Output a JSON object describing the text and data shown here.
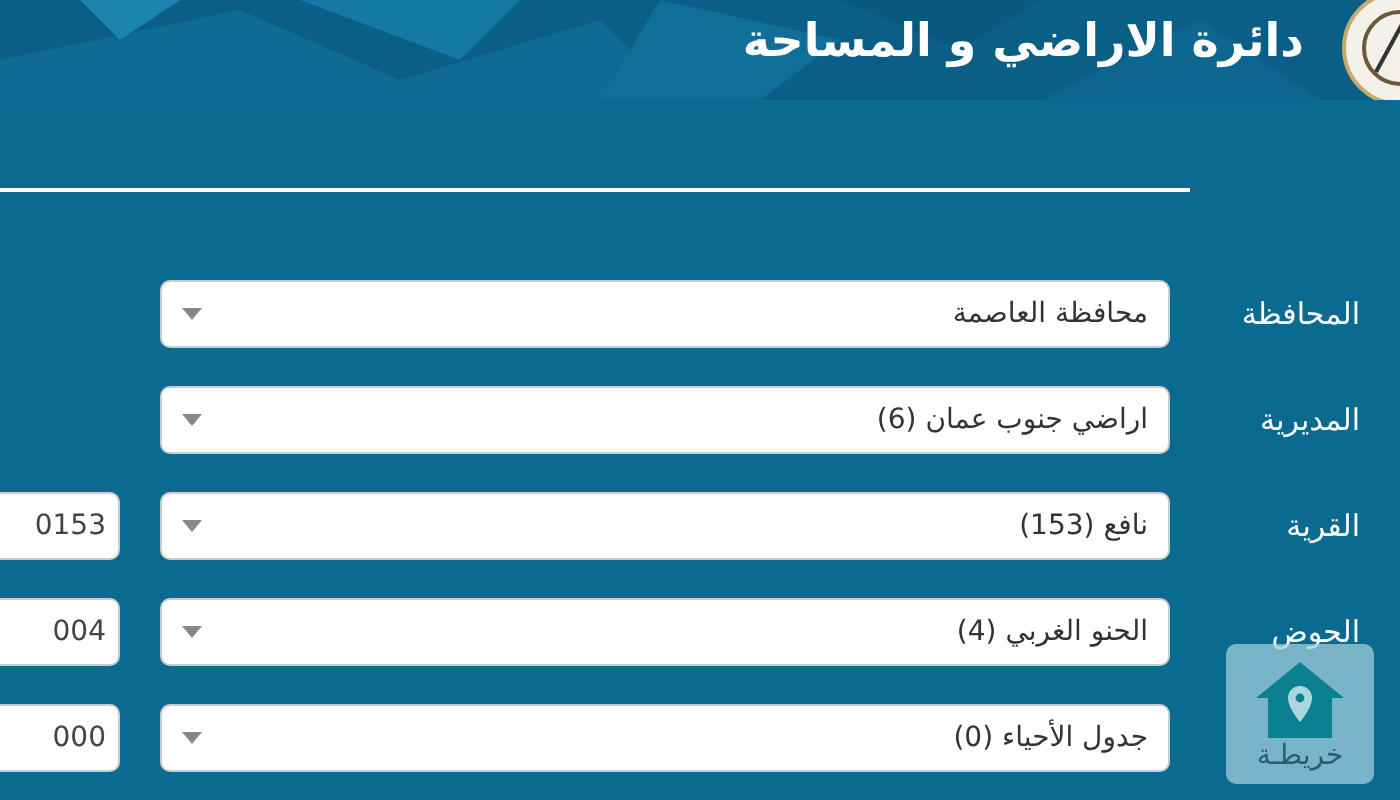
{
  "header": {
    "title": "دائرة الاراضي و المساحة"
  },
  "fields": [
    {
      "label": "المحافظة",
      "value": "محافظة العاصمة"
    },
    {
      "label": "المديرية",
      "value": "اراضي جنوب عمان (6)"
    },
    {
      "label": "القرية",
      "value": "نافع (153)",
      "code": "0153"
    },
    {
      "label": "الحوض",
      "value": "الحنو الغربي (4)",
      "code": "004"
    },
    {
      "value": "جدول الأحياء (0)",
      "code": "000"
    }
  ],
  "map_button": {
    "label": "خريطـة"
  }
}
